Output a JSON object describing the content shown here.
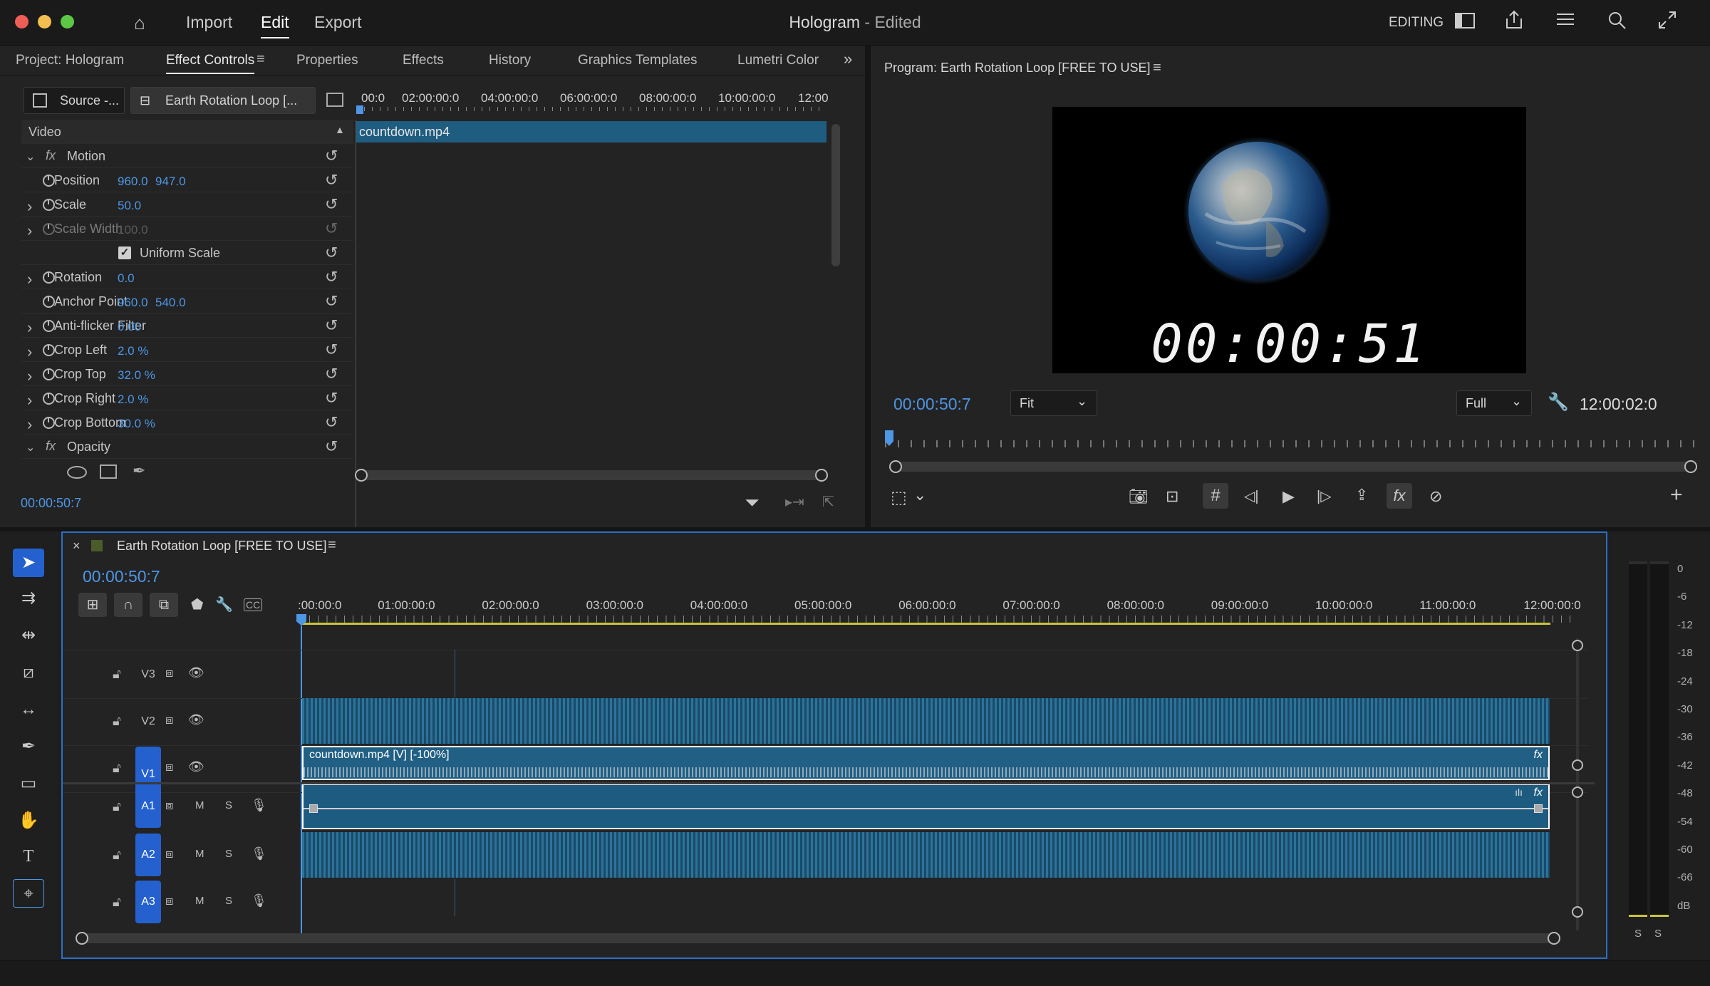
{
  "titlebar": {
    "menu": [
      "Import",
      "Edit",
      "Export"
    ],
    "active_menu": "Edit",
    "doc_title": "Hologram",
    "doc_status": "- Edited",
    "workspace": "EDITING"
  },
  "left_panel": {
    "tabs": [
      "Project: Hologram",
      "Effect Controls",
      "Properties",
      "Effects",
      "History",
      "Graphics Templates",
      "Lumetri Color"
    ],
    "active_tab": "Effect Controls",
    "source_tab": "Source -...",
    "sequence_tab": "Earth Rotation Loop [...",
    "ruler_labels": [
      "00:0",
      "02:00:00:0",
      "04:00:00:0",
      "06:00:00:0",
      "08:00:00:0",
      "10:00:00:0",
      "12:00"
    ],
    "clip_name": "countdown.mp4",
    "section": "Video",
    "motion_label": "Motion",
    "opacity_label": "Opacity",
    "properties": [
      {
        "name": "Position",
        "v1": "960.0",
        "v2": "947.0",
        "expandable": false
      },
      {
        "name": "Scale",
        "v1": "50.0",
        "v2": "",
        "expandable": true
      },
      {
        "name": "Scale Width",
        "v1": "100.0",
        "v2": "",
        "expandable": true,
        "disabled": true
      },
      {
        "name": "Uniform Scale",
        "checkbox": true
      },
      {
        "name": "Rotation",
        "v1": "0.0",
        "v2": "",
        "expandable": true
      },
      {
        "name": "Anchor Point",
        "v1": "960.0",
        "v2": "540.0",
        "expandable": false
      },
      {
        "name": "Anti-flicker Filter",
        "v1": "0.00",
        "v2": "",
        "expandable": true
      },
      {
        "name": "Crop Left",
        "v1": "2.0 %",
        "v2": "",
        "expandable": true
      },
      {
        "name": "Crop Top",
        "v1": "32.0 %",
        "v2": "",
        "expandable": true
      },
      {
        "name": "Crop Right",
        "v1": "2.0 %",
        "v2": "",
        "expandable": true
      },
      {
        "name": "Crop Bottom",
        "v1": "30.0 %",
        "v2": "",
        "expandable": true
      }
    ],
    "timecode": "00:00:50:7"
  },
  "program": {
    "title": "Program: Earth Rotation Loop [FREE TO USE]",
    "overlay_timecode": "00:00:51",
    "current_time": "00:00:50:7",
    "fit": "Fit",
    "quality": "Full",
    "duration": "12:00:02:0"
  },
  "timeline": {
    "title": "Earth Rotation Loop [FREE TO USE]",
    "timecode": "00:00:50:7",
    "ruler_labels": [
      ":00:00:0",
      "01:00:00:0",
      "02:00:00:0",
      "03:00:00:0",
      "04:00:00:0",
      "05:00:00:0",
      "06:00:00:0",
      "07:00:00:0",
      "08:00:00:0",
      "09:00:00:0",
      "10:00:00:0",
      "11:00:00:0",
      "12:00:00:0"
    ],
    "tracks_video": [
      "V3",
      "V2",
      "V1"
    ],
    "tracks_audio": [
      "A1",
      "A2",
      "A3"
    ],
    "v1_clip": "countdown.mp4 [V] [-100%]",
    "m_label": "M",
    "s_label": "S",
    "fx_label": "fx"
  },
  "meter": {
    "scale": [
      "0",
      "-6",
      "-12",
      "-18",
      "-24",
      "-30",
      "-36",
      "-42",
      "-48",
      "-54",
      "-60",
      "-66",
      "dB"
    ],
    "solo": [
      "S",
      "S"
    ]
  }
}
